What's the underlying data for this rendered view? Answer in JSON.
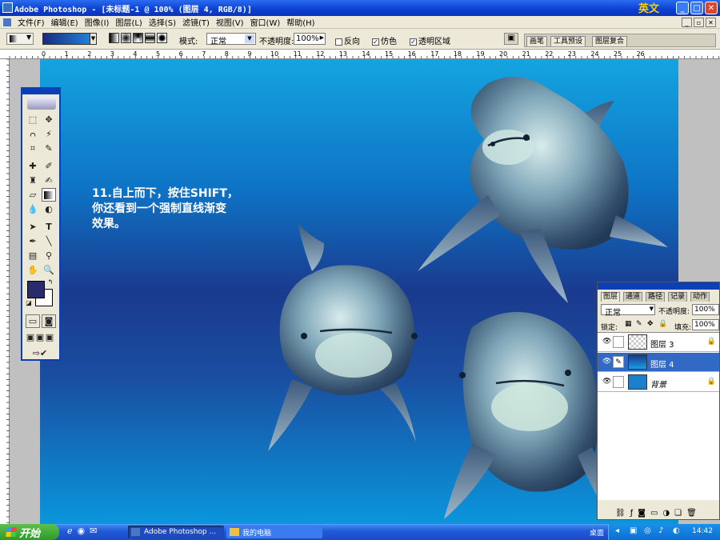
{
  "window": {
    "title": "Adobe Photoshop - [未标题-1 @ 100% (图层 4, RGB/8)]",
    "ime": "英文"
  },
  "menu": [
    "文件(F)",
    "编辑(E)",
    "图像(I)",
    "图层(L)",
    "选择(S)",
    "滤镜(T)",
    "视图(V)",
    "窗口(W)",
    "帮助(H)"
  ],
  "options": {
    "mode_label": "模式:",
    "mode_value": "正常",
    "opacity_label": "不透明度:",
    "opacity_value": "100%",
    "reverse_label": "反向",
    "dither_label": "仿色",
    "transparency_label": "透明区域"
  },
  "palette_tabs": [
    "画笔",
    "工具预设",
    "图层复合"
  ],
  "ruler_labels": [
    "0",
    "1",
    "2",
    "3",
    "4",
    "5",
    "6",
    "7",
    "8",
    "9",
    "10",
    "11",
    "12",
    "13",
    "14",
    "15",
    "16",
    "17",
    "18",
    "19",
    "20",
    "21",
    "22",
    "23",
    "24",
    "25",
    "26"
  ],
  "instruction_text": "11.自上而下，按住SHIFT，\n你还看到一个强制直线渐变\n效果。",
  "colors": {
    "foreground": "#2a2b6c",
    "background": "#ffffff"
  },
  "layers_panel": {
    "tabs": [
      "图层",
      "通道",
      "路径",
      "记录",
      "动作"
    ],
    "blend_mode": "正常",
    "opacity_label": "不透明度:",
    "opacity_value": "100%",
    "lock_label": "锁定:",
    "fill_label": "填充:",
    "fill_value": "100%",
    "layers": [
      {
        "name": "图层 3",
        "selected": false
      },
      {
        "name": "图层 4",
        "selected": true
      },
      {
        "name": "背景",
        "selected": false
      }
    ]
  },
  "taskbar": {
    "start_label": "开始",
    "tasks": [
      "Adobe Photoshop ...",
      "我的电脑"
    ],
    "tray_label": "桌面",
    "clock": "14:42"
  }
}
